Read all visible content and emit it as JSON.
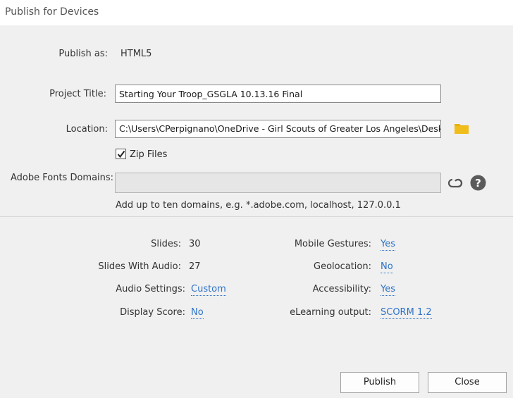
{
  "window": {
    "title": "Publish for Devices"
  },
  "publish_as": {
    "label": "Publish as:",
    "value": "HTML5"
  },
  "project_title": {
    "label": "Project Title:",
    "value": "Starting Your Troop_GSGLA 10.13.16 Final"
  },
  "location": {
    "label": "Location:",
    "value": "C:\\Users\\CPerpignano\\OneDrive - Girl Scouts of Greater Los Angeles\\Desktop"
  },
  "zip_files": {
    "label": "Zip Files",
    "checked": true
  },
  "adobe_fonts": {
    "label": "Adobe Fonts Domains:",
    "value": "",
    "hint": "Add up to ten domains, e.g. *.adobe.com, localhost, 127.0.0.1"
  },
  "stats": {
    "slides": {
      "label": "Slides:",
      "value": "30"
    },
    "slides_with_audio": {
      "label": "Slides With Audio:",
      "value": "27"
    },
    "audio_settings": {
      "label": "Audio Settings:",
      "value": "Custom"
    },
    "display_score": {
      "label": "Display Score:",
      "value": "No"
    },
    "mobile_gestures": {
      "label": "Mobile Gestures:",
      "value": "Yes"
    },
    "geolocation": {
      "label": "Geolocation:",
      "value": "No"
    },
    "accessibility": {
      "label": "Accessibility:",
      "value": "Yes"
    },
    "elearning_output": {
      "label": "eLearning output:",
      "value": "SCORM 1.2"
    }
  },
  "buttons": {
    "publish": "Publish",
    "close": "Close"
  },
  "colors": {
    "link": "#2d72c7",
    "folder": "#e8b10a",
    "background": "#f0f0f0"
  },
  "icons": [
    "folder-icon",
    "creative-cloud-icon",
    "help-icon",
    "checkmark-icon"
  ]
}
